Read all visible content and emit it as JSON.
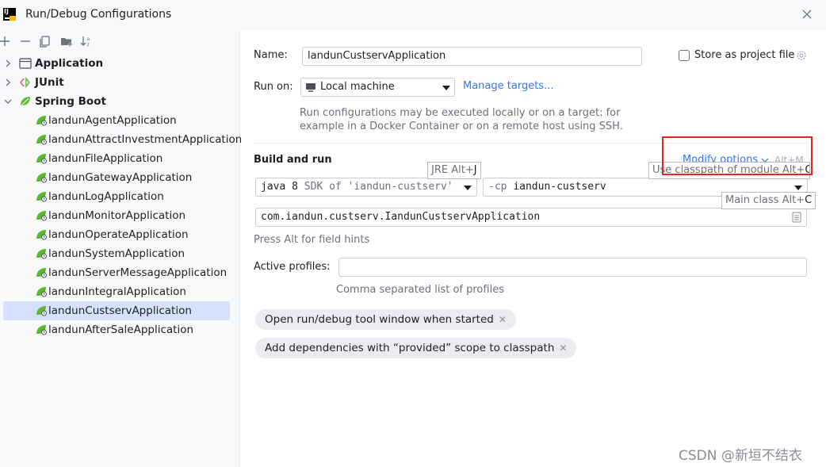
{
  "window": {
    "title": "Run/Debug Configurations",
    "app_logo_text": "IJ"
  },
  "tree": {
    "groups": [
      {
        "label": "Application",
        "icon": "application-window-icon",
        "expanded": false
      },
      {
        "label": "JUnit",
        "icon": "junit-icon",
        "expanded": false
      },
      {
        "label": "Spring Boot",
        "icon": "spring-boot-icon",
        "expanded": true
      }
    ],
    "items": [
      "landunAgentApplication",
      "landunAttractInvestmentApplication",
      "landunFileApplication",
      "landunGatewayApplication",
      "landunLogApplication",
      "landunMonitorApplication",
      "landunOperateApplication",
      "landunSystemApplication",
      "landunServerMessageApplication",
      "landunIntegralApplication",
      "landunCustservApplication",
      "landunAfterSaleApplication"
    ],
    "selected_index": 10
  },
  "form": {
    "name_label": "Name:",
    "name_value": "landunCustservApplication",
    "store_label": "Store as project file",
    "run_on_label": "Run on:",
    "run_on_value": "Local machine",
    "manage_targets": "Manage targets...",
    "run_hint_1": "Run configurations may be executed locally or on a target: for",
    "run_hint_2": "example in a Docker Container or on a remote host using SSH.",
    "build_run_label": "Build and run",
    "modify_options": "Modify options",
    "modify_shortcut": "Alt+M",
    "jre_prefix": "java 8",
    "jre_sdk": "SDK of 'iandun-custserv'",
    "cp_prefix": "-cp",
    "cp_value": "iandun-custserv",
    "main_class": "com.iandun.custserv.IandunCustservApplication",
    "field_hint": "Press Alt for field hints",
    "profiles_label": "Active profiles:",
    "profiles_value": "",
    "profiles_hint": "Comma separated list of profiles",
    "tags": [
      "Open run/debug tool window when started",
      "Add dependencies with “provided” scope to classpath"
    ]
  },
  "tooltips": {
    "jre_text": "JRE Alt+",
    "jre_key": "J",
    "classpath_text": "Use classpath of module Alt+",
    "classpath_key": "O",
    "main_class_text": "Main class Alt+",
    "main_class_key": "C"
  },
  "colors": {
    "accent": "#3574f0",
    "selection": "#d5e1ff",
    "spring_green": "#5fb832",
    "highlight_red": "#e5241f"
  },
  "watermark": "CSDN @新垣不结衣"
}
